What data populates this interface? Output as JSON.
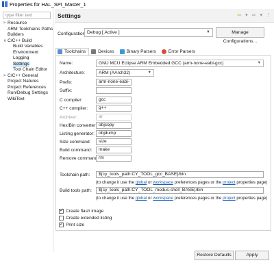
{
  "window": {
    "title": "Properties for HAL_SPI_Master_1"
  },
  "filter": {
    "placeholder": "type filter text"
  },
  "tree": [
    {
      "label": "Resource",
      "arrow": ">",
      "indent": 0,
      "selected": false
    },
    {
      "label": "ARM Toolchains Paths",
      "arrow": "",
      "indent": 0,
      "selected": false
    },
    {
      "label": "Builders",
      "arrow": "",
      "indent": 0,
      "selected": false
    },
    {
      "label": "C/C++ Build",
      "arrow": "v",
      "indent": 0,
      "selected": false
    },
    {
      "label": "Build Variables",
      "arrow": "",
      "indent": 1,
      "selected": false
    },
    {
      "label": "Environment",
      "arrow": "",
      "indent": 1,
      "selected": false
    },
    {
      "label": "Logging",
      "arrow": "",
      "indent": 1,
      "selected": false
    },
    {
      "label": "Settings",
      "arrow": "",
      "indent": 1,
      "selected": true
    },
    {
      "label": "Tool Chain Editor",
      "arrow": "",
      "indent": 1,
      "selected": false
    },
    {
      "label": "C/C++ General",
      "arrow": ">",
      "indent": 0,
      "selected": false
    },
    {
      "label": "Project Natures",
      "arrow": "",
      "indent": 0,
      "selected": false
    },
    {
      "label": "Project References",
      "arrow": "",
      "indent": 0,
      "selected": false
    },
    {
      "label": "Run/Debug Settings",
      "arrow": "",
      "indent": 0,
      "selected": false
    },
    {
      "label": "WikiText",
      "arrow": "",
      "indent": 0,
      "selected": false
    }
  ],
  "header": {
    "title": "Settings"
  },
  "configuration": {
    "label": "Configuration:",
    "value": "Debug  [ Active ]",
    "manage_button": "Manage Configurations..."
  },
  "tabs": [
    {
      "label": "Toolchains",
      "icon": "toolchain-icon",
      "active": true
    },
    {
      "label": "Devices",
      "icon": "device-icon",
      "active": false
    },
    {
      "label": "Binary Parsers",
      "icon": "binary-parser-icon",
      "active": false
    },
    {
      "label": "Error Parsers",
      "icon": "error-parser-icon",
      "active": false
    }
  ],
  "fields": {
    "name": {
      "label": "Name:",
      "value": "GNU MCU Eclipse ARM Embedded GCC (arm-none-eabi-gcc)"
    },
    "architecture": {
      "label": "Architecture:",
      "value": "ARM (AArch32)"
    },
    "prefix": {
      "label": "Prefix:",
      "value": "arm-none-eabi-"
    },
    "suffix": {
      "label": "Suffix:",
      "value": ""
    },
    "c_compiler": {
      "label": "C compiler:",
      "value": "gcc"
    },
    "cpp_compiler": {
      "label": "C++ compiler:",
      "value": "g++"
    },
    "archiver": {
      "label": "Archiver:",
      "value": "ar"
    },
    "hex_bin": {
      "label": "Hex/Bin converter:",
      "value": "objcopy"
    },
    "listing": {
      "label": "Listing generator:",
      "value": "objdump"
    },
    "size": {
      "label": "Size command:",
      "value": "size"
    },
    "build": {
      "label": "Build command:",
      "value": "make"
    },
    "remove": {
      "label": "Remove command:",
      "value": "rm"
    },
    "toolchain_path": {
      "label": "Toolchain path:",
      "value": "${cy_tools_path:CY_TOOL_gcc_BASE}/bin"
    },
    "build_tools_path": {
      "label": "Build tools path:",
      "value": "${cy_tools_path:CY_TOOL_modus-shell_BASE}/bin"
    }
  },
  "notes": {
    "prefix": "(to change it use the ",
    "global": "global",
    "or": " or ",
    "workspace": "workspace",
    "middle": " preferences pages or the ",
    "project": "project",
    "suffix": " properties page)"
  },
  "checkboxes": [
    {
      "label": "Create flash image",
      "checked": true
    },
    {
      "label": "Create extended listing",
      "checked": false
    },
    {
      "label": "Print size",
      "checked": true
    }
  ],
  "buttons": {
    "restore": "Restore Defaults",
    "apply": "Apply"
  },
  "help": {
    "glyph": "?"
  }
}
